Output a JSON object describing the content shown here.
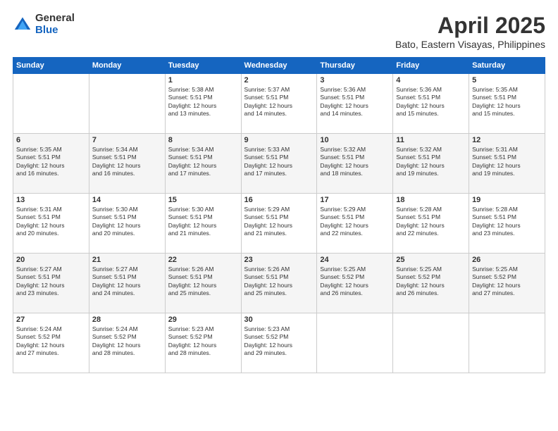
{
  "logo": {
    "general": "General",
    "blue": "Blue"
  },
  "title": "April 2025",
  "location": "Bato, Eastern Visayas, Philippines",
  "days_of_week": [
    "Sunday",
    "Monday",
    "Tuesday",
    "Wednesday",
    "Thursday",
    "Friday",
    "Saturday"
  ],
  "weeks": [
    [
      {
        "day": "",
        "info": ""
      },
      {
        "day": "",
        "info": ""
      },
      {
        "day": "1",
        "info": "Sunrise: 5:38 AM\nSunset: 5:51 PM\nDaylight: 12 hours\nand 13 minutes."
      },
      {
        "day": "2",
        "info": "Sunrise: 5:37 AM\nSunset: 5:51 PM\nDaylight: 12 hours\nand 14 minutes."
      },
      {
        "day": "3",
        "info": "Sunrise: 5:36 AM\nSunset: 5:51 PM\nDaylight: 12 hours\nand 14 minutes."
      },
      {
        "day": "4",
        "info": "Sunrise: 5:36 AM\nSunset: 5:51 PM\nDaylight: 12 hours\nand 15 minutes."
      },
      {
        "day": "5",
        "info": "Sunrise: 5:35 AM\nSunset: 5:51 PM\nDaylight: 12 hours\nand 15 minutes."
      }
    ],
    [
      {
        "day": "6",
        "info": "Sunrise: 5:35 AM\nSunset: 5:51 PM\nDaylight: 12 hours\nand 16 minutes."
      },
      {
        "day": "7",
        "info": "Sunrise: 5:34 AM\nSunset: 5:51 PM\nDaylight: 12 hours\nand 16 minutes."
      },
      {
        "day": "8",
        "info": "Sunrise: 5:34 AM\nSunset: 5:51 PM\nDaylight: 12 hours\nand 17 minutes."
      },
      {
        "day": "9",
        "info": "Sunrise: 5:33 AM\nSunset: 5:51 PM\nDaylight: 12 hours\nand 17 minutes."
      },
      {
        "day": "10",
        "info": "Sunrise: 5:32 AM\nSunset: 5:51 PM\nDaylight: 12 hours\nand 18 minutes."
      },
      {
        "day": "11",
        "info": "Sunrise: 5:32 AM\nSunset: 5:51 PM\nDaylight: 12 hours\nand 19 minutes."
      },
      {
        "day": "12",
        "info": "Sunrise: 5:31 AM\nSunset: 5:51 PM\nDaylight: 12 hours\nand 19 minutes."
      }
    ],
    [
      {
        "day": "13",
        "info": "Sunrise: 5:31 AM\nSunset: 5:51 PM\nDaylight: 12 hours\nand 20 minutes."
      },
      {
        "day": "14",
        "info": "Sunrise: 5:30 AM\nSunset: 5:51 PM\nDaylight: 12 hours\nand 20 minutes."
      },
      {
        "day": "15",
        "info": "Sunrise: 5:30 AM\nSunset: 5:51 PM\nDaylight: 12 hours\nand 21 minutes."
      },
      {
        "day": "16",
        "info": "Sunrise: 5:29 AM\nSunset: 5:51 PM\nDaylight: 12 hours\nand 21 minutes."
      },
      {
        "day": "17",
        "info": "Sunrise: 5:29 AM\nSunset: 5:51 PM\nDaylight: 12 hours\nand 22 minutes."
      },
      {
        "day": "18",
        "info": "Sunrise: 5:28 AM\nSunset: 5:51 PM\nDaylight: 12 hours\nand 22 minutes."
      },
      {
        "day": "19",
        "info": "Sunrise: 5:28 AM\nSunset: 5:51 PM\nDaylight: 12 hours\nand 23 minutes."
      }
    ],
    [
      {
        "day": "20",
        "info": "Sunrise: 5:27 AM\nSunset: 5:51 PM\nDaylight: 12 hours\nand 23 minutes."
      },
      {
        "day": "21",
        "info": "Sunrise: 5:27 AM\nSunset: 5:51 PM\nDaylight: 12 hours\nand 24 minutes."
      },
      {
        "day": "22",
        "info": "Sunrise: 5:26 AM\nSunset: 5:51 PM\nDaylight: 12 hours\nand 25 minutes."
      },
      {
        "day": "23",
        "info": "Sunrise: 5:26 AM\nSunset: 5:51 PM\nDaylight: 12 hours\nand 25 minutes."
      },
      {
        "day": "24",
        "info": "Sunrise: 5:25 AM\nSunset: 5:52 PM\nDaylight: 12 hours\nand 26 minutes."
      },
      {
        "day": "25",
        "info": "Sunrise: 5:25 AM\nSunset: 5:52 PM\nDaylight: 12 hours\nand 26 minutes."
      },
      {
        "day": "26",
        "info": "Sunrise: 5:25 AM\nSunset: 5:52 PM\nDaylight: 12 hours\nand 27 minutes."
      }
    ],
    [
      {
        "day": "27",
        "info": "Sunrise: 5:24 AM\nSunset: 5:52 PM\nDaylight: 12 hours\nand 27 minutes."
      },
      {
        "day": "28",
        "info": "Sunrise: 5:24 AM\nSunset: 5:52 PM\nDaylight: 12 hours\nand 28 minutes."
      },
      {
        "day": "29",
        "info": "Sunrise: 5:23 AM\nSunset: 5:52 PM\nDaylight: 12 hours\nand 28 minutes."
      },
      {
        "day": "30",
        "info": "Sunrise: 5:23 AM\nSunset: 5:52 PM\nDaylight: 12 hours\nand 29 minutes."
      },
      {
        "day": "",
        "info": ""
      },
      {
        "day": "",
        "info": ""
      },
      {
        "day": "",
        "info": ""
      }
    ]
  ]
}
